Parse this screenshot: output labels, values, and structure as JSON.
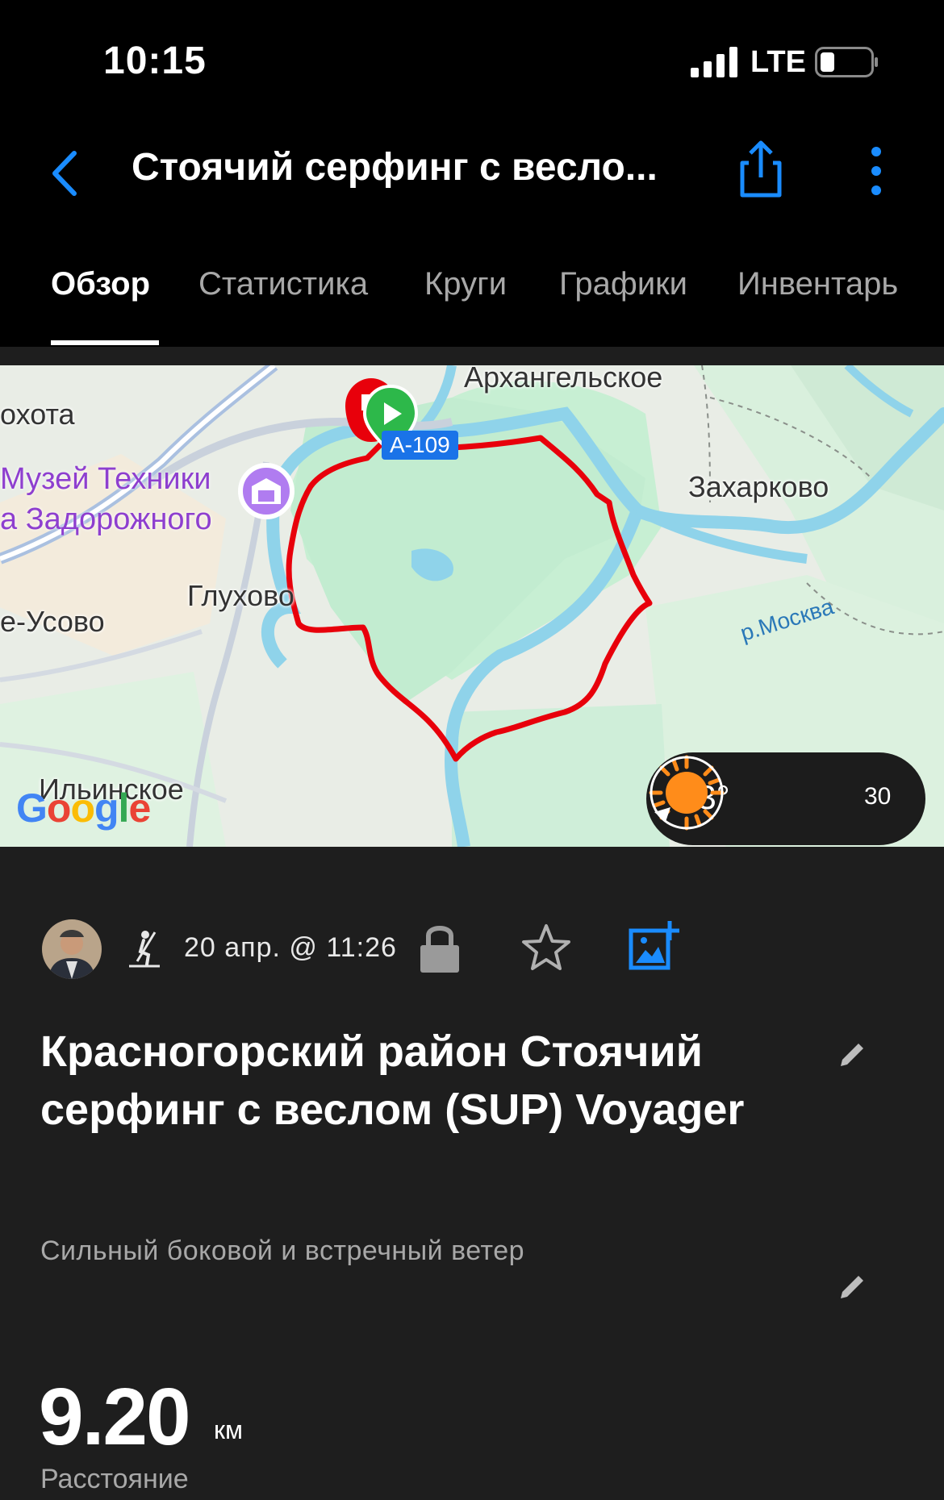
{
  "status_bar": {
    "time": "10:15",
    "network": "LTE"
  },
  "nav": {
    "title": "Стоячий серфинг с весло..."
  },
  "tabs": [
    {
      "label": "Обзор",
      "active": true
    },
    {
      "label": "Статистика",
      "active": false
    },
    {
      "label": "Круги",
      "active": false
    },
    {
      "label": "Графики",
      "active": false
    },
    {
      "label": "Инвентарь",
      "active": false
    }
  ],
  "map": {
    "places": {
      "arkhangelskoe": "Архангельское",
      "okhota": "охота",
      "zakharkovo": "Захарково",
      "glukhovo": "Глухово",
      "usovo": "е-Усово",
      "ilyinskoe": "Ильинское"
    },
    "museum_line1": "Музей Техники",
    "museum_line2": "а Задорожного",
    "road": "А-109",
    "river": "р.Москва",
    "logo": "Google",
    "weather": {
      "temperature": "23°",
      "wind": "30"
    },
    "route_color": "#e8000b"
  },
  "activity": {
    "date": "20 апр. @ 11:26",
    "title": "Красногорский район Стоячий серфинг с веслом (SUP) Voyager",
    "description": "Сильный боковой и встречный ветер",
    "distance_value": "9.20",
    "distance_unit": "км",
    "distance_label": "Расстояние"
  },
  "colors": {
    "accent": "#1a8cff",
    "background": "#1e1e1e",
    "header": "#000000"
  }
}
